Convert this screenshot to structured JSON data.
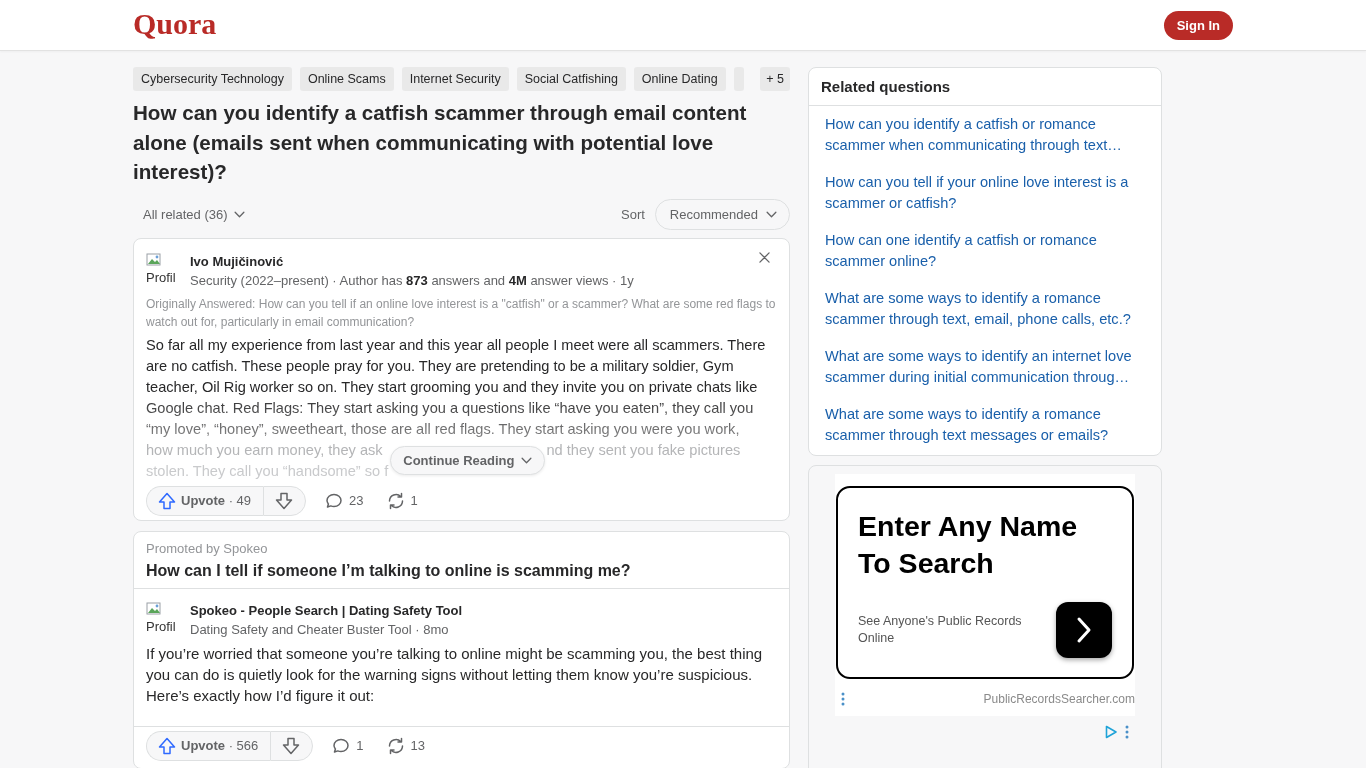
{
  "header": {
    "logo": "Quora",
    "sign_in": "Sign In"
  },
  "question": {
    "topics": [
      "Cybersecurity Technology",
      "Online Scams",
      "Internet Security",
      "Social Catfishing",
      "Online Dating"
    ],
    "more_topics": "+ 5",
    "title": "How can you identify a catfish scammer through email content alone (emails sent when communicating with potential love interest)?"
  },
  "filters": {
    "all_related": "All related (36)",
    "sort_label": "Sort",
    "sort_value": "Recommended"
  },
  "answer": {
    "avatar_alt": "Profil",
    "author": "Ivo Mujičinović",
    "credential": "Security (2022–present) · Author has **873** answers and **4M** answer views · 1y",
    "originally_answered": "Originally Answered: How can you tell if an online love interest is a \"catfish\" or a scammer? What are some red flags to watch out for, particularly in email communication?",
    "body": "So far all my experience from last year and this year all people I meet were all scammers. There are no catfish. These people pray for you. They are pretending to be a military soldier, Gym teacher, Oil Rig worker so on. They start grooming you and they invite you on private chats like Google chat. Red Flags: They start asking you a questions like “have you eaten”, they call you “my love”, “honey”, sweetheart, those are all red flags. They start asking you were you work,",
    "faded_left": [
      "how much you earn money, they ask",
      "stolen. They call you “handsome” so f"
    ],
    "faded_right": "nd they sent you fake pictures",
    "continue_reading": "Continue Reading",
    "upvote": "**Upvote** · 49",
    "comments": "23",
    "shares": "1"
  },
  "promoted": {
    "label": "Promoted by Spokeo",
    "question": "How can I tell if someone I’m talking to online is scamming me?",
    "avatar_alt": "Profil",
    "author": "Spokeo - People Search | Dating Safety Tool",
    "tagline": "Dating Safety and Cheater Buster Tool · 8mo",
    "body": "If you’re worried that someone you’re talking to online might be scamming you, the best thing you can do is quietly look for the warning signs without letting them know you’re suspicious. Here’s exactly how I’d figure it out:",
    "upvote": "**Upvote** · 566",
    "comments": "1",
    "shares": "13"
  },
  "related_questions": {
    "title": "Related questions",
    "items": [
      "How can you identify a catfish or romance scammer when communicating through text…",
      "How can you tell if your online love interest is a scammer or catfish?",
      "How can one identify a catfish or romance scammer online?",
      "What are some ways to identify a romance scammer through text, email, phone calls, etc.?",
      "What are some ways to identify an internet love scammer during initial communication throug…",
      "What are some ways to identify a romance scammer through text messages or emails?"
    ]
  },
  "ad": {
    "headline": "Enter Any Name To Search",
    "subtext": "See Anyone's Public Records Online",
    "domain": "PublicRecordsSearcher.com"
  }
}
